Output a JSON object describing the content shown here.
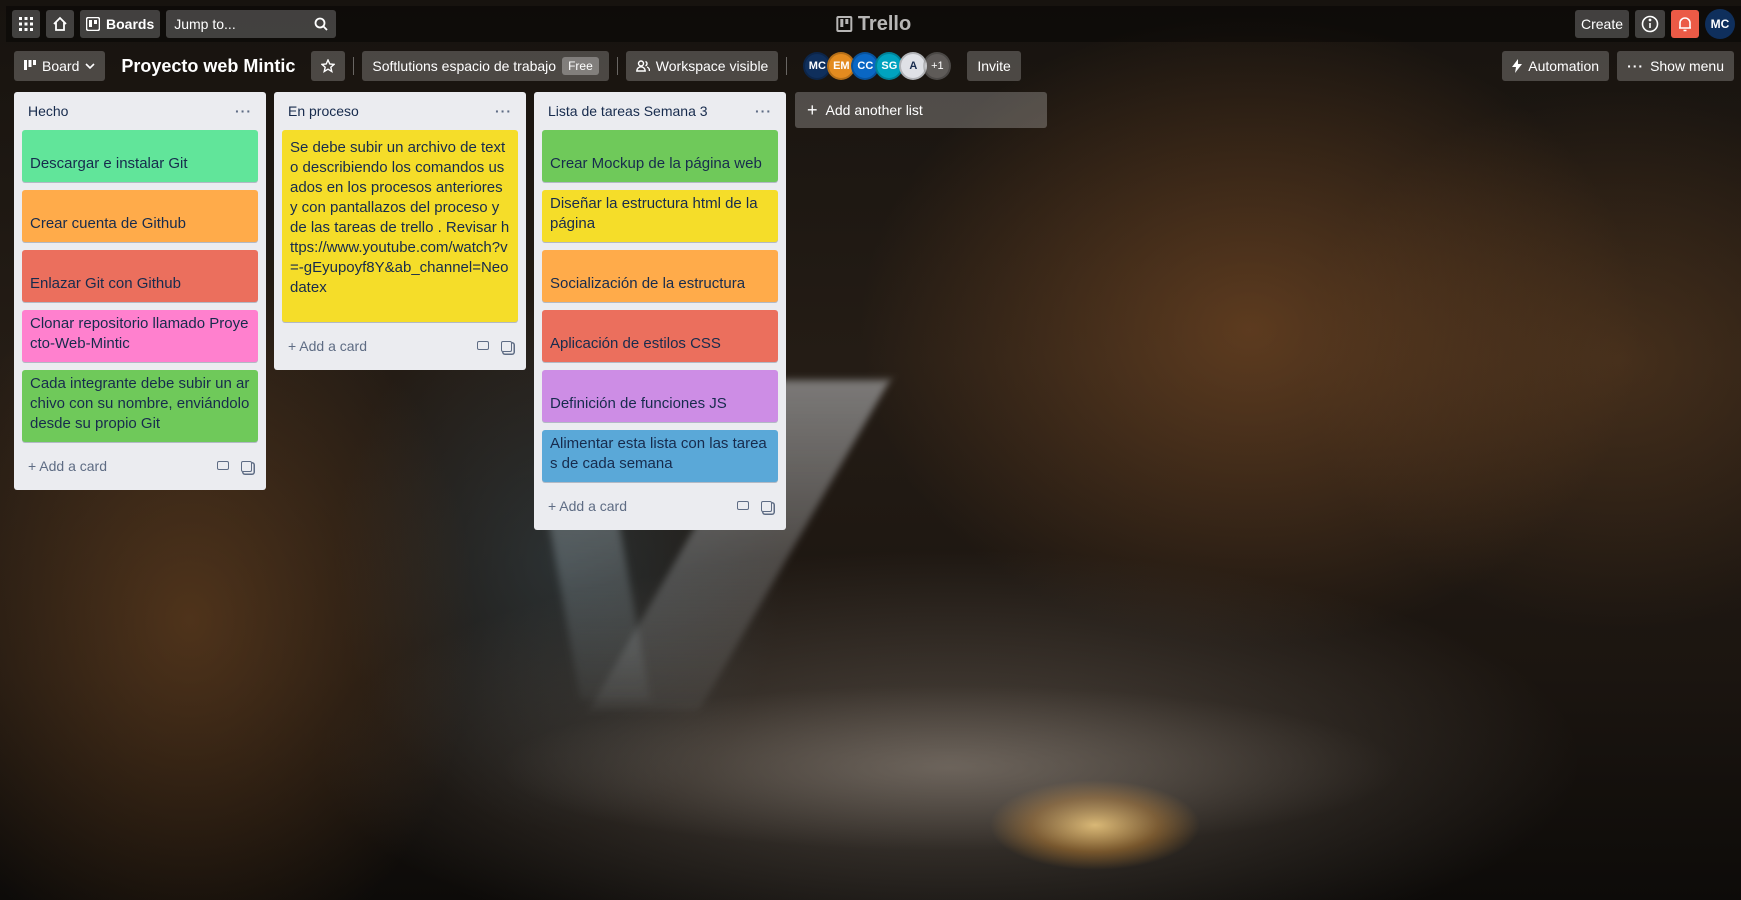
{
  "topnav": {
    "apps_icon": "grid-icon",
    "home_icon": "home-icon",
    "boards_label": "Boards",
    "search_placeholder": "Jump to...",
    "logo_text": "Trello",
    "create_label": "Create",
    "info_icon": "info-icon",
    "bell_icon": "bell-icon",
    "user_initials": "MC"
  },
  "board_header": {
    "view_label": "Board",
    "title": "Proyecto web Mintic",
    "workspace_name": "Softlutions espacio de trabajo",
    "workspace_badge": "Free",
    "visibility_label": "Workspace visible",
    "members": [
      {
        "initials": "MC",
        "color": "#0f2f5c"
      },
      {
        "initials": "EM",
        "color": "#e38b1f"
      },
      {
        "initials": "CC",
        "color": "#0a67c4"
      },
      {
        "initials": "SG",
        "color": "#00a3bf"
      },
      {
        "initials": "A",
        "color": "#dfe1e6"
      }
    ],
    "extra_members": "+1",
    "invite_label": "Invite",
    "automation_label": "Automation",
    "show_menu_label": "Show menu"
  },
  "lists": [
    {
      "title": "Hecho",
      "cards": [
        {
          "text": "Descargar e instalar Git",
          "color": "#61e59a"
        },
        {
          "text": "Crear cuenta de Github",
          "color": "#ffab4a"
        },
        {
          "text": "Enlazar Git con Github",
          "color": "#eb6f5d"
        },
        {
          "text": "Clonar repositorio llamado Proyecto-Web-Mintic",
          "color": "#ff80ce"
        },
        {
          "text": "Cada integrante debe subir un archivo con su nombre, enviándolo desde su propio Git",
          "color": "#6fc95a"
        }
      ],
      "add_card": "Add a card"
    },
    {
      "title": "En proceso",
      "cards": [
        {
          "text": "Se debe subir un archivo de texto describiendo los comandos usados en los procesos anteriores y con pantallazos del proceso y de las tareas de trello . Revisar https://www.youtube.com/watch?v=-gEyupoyf8Y&ab_channel=Neodatex",
          "color": "#f5dd29"
        }
      ],
      "add_card": "Add a card"
    },
    {
      "title": "Lista de tareas Semana 3",
      "cards": [
        {
          "text": "Crear Mockup de la página web",
          "color": "#6fc95a"
        },
        {
          "text": "Diseñar la estructura html de la página",
          "color": "#f5dd29"
        },
        {
          "text": "Socialización de la estructura",
          "color": "#ffab4a"
        },
        {
          "text": "Aplicación de estilos CSS",
          "color": "#eb6f5d"
        },
        {
          "text": "Definición de funciones JS",
          "color": "#cd8de5"
        },
        {
          "text": "Alimentar esta lista con las tareas de cada semana",
          "color": "#5aa8d8"
        }
      ],
      "add_card": "Add a card"
    }
  ],
  "add_list_label": "Add another list"
}
